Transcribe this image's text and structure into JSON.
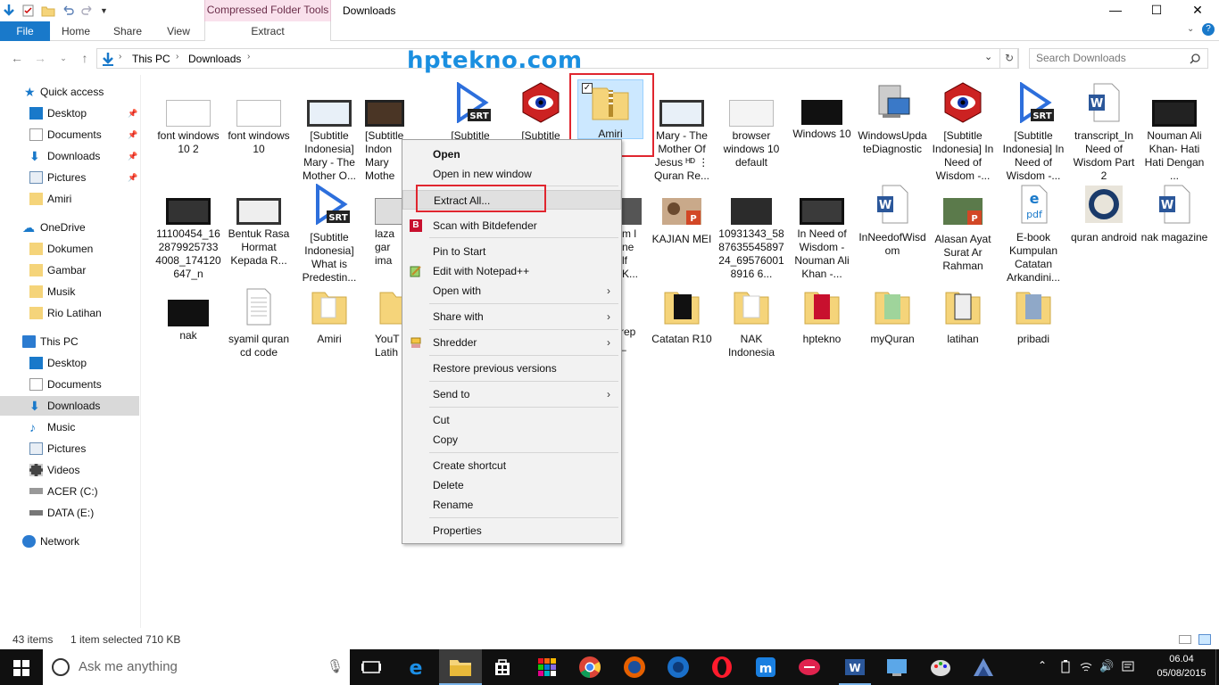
{
  "window": {
    "title": "Downloads",
    "context_tab_group": "Compressed Folder Tools",
    "controls": {
      "minimize": "—",
      "maximize": "☐",
      "close": "✕"
    }
  },
  "ribbon": {
    "tabs": [
      "File",
      "Home",
      "Share",
      "View",
      "Extract"
    ]
  },
  "address": {
    "breadcrumb": [
      "This PC",
      "Downloads"
    ],
    "search_placeholder": "Search Downloads"
  },
  "watermark": "hptekno.com",
  "nav": {
    "quick_access": "Quick access",
    "quick_items": [
      "Desktop",
      "Documents",
      "Downloads",
      "Pictures",
      "Amiri"
    ],
    "onedrive": "OneDrive",
    "onedrive_items": [
      "Dokumen",
      "Gambar",
      "Musik",
      "Rio Latihan"
    ],
    "this_pc": "This PC",
    "pc_items": [
      "Desktop",
      "Documents",
      "Downloads",
      "Music",
      "Pictures",
      "Videos",
      "ACER (C:)",
      "DATA (E:)"
    ],
    "network": "Network"
  },
  "files": {
    "row1": [
      "font windows 10 2",
      "font windows 10",
      "[Subtitle Indonesia] Mary - The Mother O...",
      "[Subtitle Indon Mary Mothe",
      "[Subtitle",
      "[Subtitle",
      "Amiri",
      "Mary - The Mother Of Jesus ᴴᴰ ⋮ Quran Re...",
      "browser windows 10 default",
      "Windows 10",
      "WindowsUpdateDiagnostic",
      "[Subtitle Indonesia] In Need of Wisdom -...",
      "[Subtitle Indonesia] In Need of Wisdom -...",
      "transcript_In Need of Wisdom Part 2",
      "Nouman Ali Khan- Hati Hati Dengan ..."
    ],
    "row2": [
      "11100454_162879925733 4008_174120647_n",
      "Bentuk Rasa Hormat Kepada R...",
      "[Subtitle Indonesia] What is Predestin...",
      "laza gar ima",
      "m l ne lf K...",
      "KAJIAN MEI",
      "10931343_588763554589724_695760018916 6...",
      "In Need of Wisdom - Nouman Ali Khan -...",
      "InNeedofWisdom",
      "Alasan Ayat Surat Ar Rahman",
      "E-book Kumpulan Catatan Arkandini...",
      "quran android",
      "nak magazine"
    ],
    "row3": [
      "nak",
      "syamil quran cd code",
      "Amiri",
      "YouT Latih",
      "rep_",
      "Catatan R10",
      "NAK Indonesia",
      "hptekno",
      "myQuran",
      "latihan",
      "pribadi"
    ]
  },
  "context_menu": {
    "open": "Open",
    "open_new_window": "Open in new window",
    "extract_all": "Extract All...",
    "scan": "Scan with Bitdefender",
    "pin_start": "Pin to Start",
    "edit_notepad": "Edit with Notepad++",
    "open_with": "Open with",
    "share_with": "Share with",
    "shredder": "Shredder",
    "restore": "Restore previous versions",
    "send_to": "Send to",
    "cut": "Cut",
    "copy": "Copy",
    "create_shortcut": "Create shortcut",
    "delete": "Delete",
    "rename": "Rename",
    "properties": "Properties"
  },
  "status": {
    "count": "43 items",
    "selection": "1 item selected  710 KB"
  },
  "taskbar": {
    "search_placeholder": "Ask me anything",
    "time": "06.04",
    "date": "05/08/2015"
  },
  "colors": {
    "accent": "#1979ca",
    "highlight_box": "#e0262f",
    "watermark": "#1a8fe0",
    "taskbar": "#101010"
  }
}
